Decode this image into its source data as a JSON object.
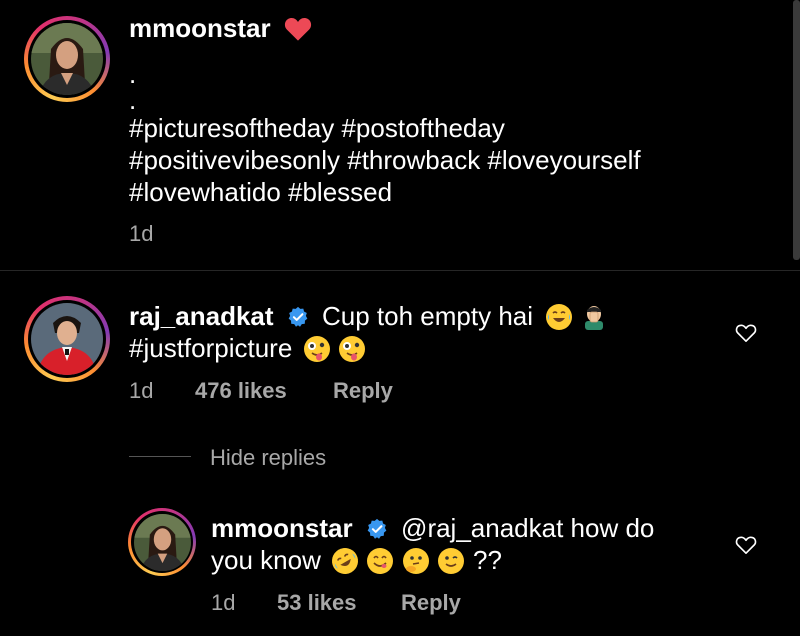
{
  "caption": {
    "username": "mmoonstar",
    "dot1": ".",
    "dot2": ".",
    "line1": "#picturesoftheday #postoftheday",
    "line2": "#positivevibesonly #throwback #loveyourself",
    "line3": "#lovewhatido #blessed",
    "time": "1d"
  },
  "comment": {
    "username": "raj_anadkat",
    "text_line1": "Cup toh empty hai",
    "text_line2": "#justforpicture",
    "time": "1d",
    "likes": "476 likes",
    "reply_label": "Reply",
    "hide_replies": "Hide replies"
  },
  "reply": {
    "username": "mmoonstar",
    "text_line1": "@raj_anadkat how do",
    "text_line2a": "you know",
    "text_line2b": "??",
    "time": "1d",
    "likes": "53 likes",
    "reply_label": "Reply"
  },
  "colors": {
    "background": "#000000",
    "muted": "#a8a8a8",
    "heart_red": "#ed4956",
    "verified_blue": "#3897f0"
  }
}
